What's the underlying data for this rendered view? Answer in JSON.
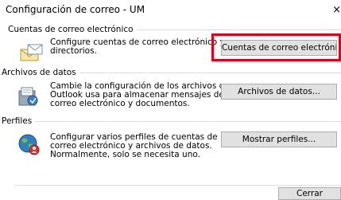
{
  "window": {
    "title": "Configuración de correo - UM",
    "close_glyph": "×"
  },
  "sections": [
    {
      "title": "Cuentas de correo electrónico",
      "description": [
        "Configure cuentas de correo electrónico y",
        "directorios."
      ],
      "button_label": "Cuentas de correo electrónico...",
      "icon": "envelope-icon"
    },
    {
      "title": "Archivos de datos",
      "description": [
        "Cambie la configuración de los archivos que",
        "Outlook usa para almacenar mensajes de",
        "correo electrónico y documentos."
      ],
      "button_label": "Archivos de datos...",
      "icon": "data-files-icon"
    },
    {
      "title": "Perfiles",
      "description": [
        "Configurar varios perfiles de cuentas de",
        "correo electrónico y archivos de datos.",
        "Normalmente, solo se necesita uno."
      ],
      "button_label": "Mostrar perfiles...",
      "icon": "profiles-globe-icon"
    }
  ],
  "footer": {
    "close_label": "Cerrar"
  },
  "colors": {
    "highlight": "#e0001b",
    "button_bg": "#e1e1e1",
    "button_border": "#adadad"
  }
}
